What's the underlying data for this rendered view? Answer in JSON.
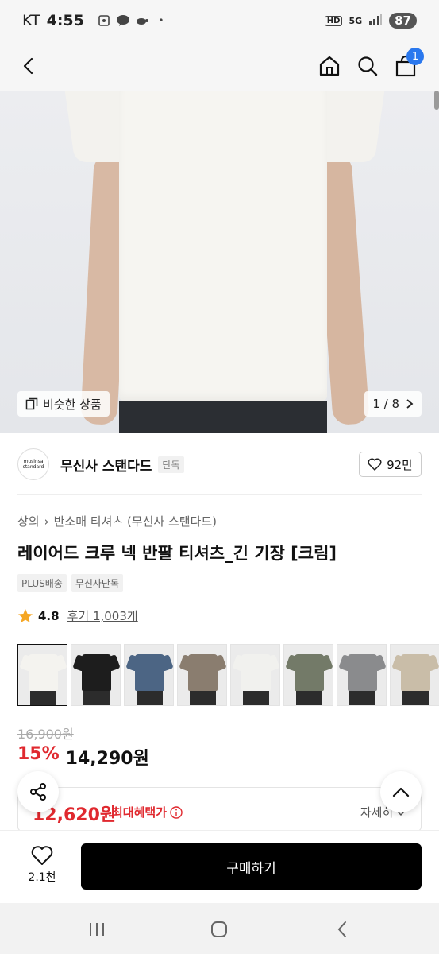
{
  "status_bar": {
    "carrier": "KT",
    "time": "4:55",
    "notification_icons": [
      "screenshot-icon",
      "talk-icon",
      "turtle-icon"
    ],
    "dot": "•",
    "hd": "HD",
    "network": "5G",
    "battery": "87"
  },
  "header": {
    "cart_count": "1"
  },
  "hero": {
    "similar_label": "비슷한 상품",
    "page_indicator": "1 / 8"
  },
  "brand": {
    "logo_line1": "musinsa",
    "logo_line2": "standard",
    "name": "무신사 스탠다드",
    "tag": "단독",
    "likes": "92만"
  },
  "product": {
    "breadcrumb": [
      "상의",
      "반소매 티셔츠 (무신사 스탠다드)"
    ],
    "title": "레이어드 크루 넥 반팔 티셔츠_긴 기장 [크림]",
    "tags": [
      "PLUS배송",
      "무신사단독"
    ],
    "rating": "4.8",
    "reviews": "후기 1,003개",
    "colors": [
      "#f4f3ef",
      "#1d1d1d",
      "#4c6584",
      "#8a7d6f",
      "#f1f1ee",
      "#737a68",
      "#8a8b8d",
      "#c9bda8"
    ]
  },
  "price": {
    "original": "16,900원",
    "discount": "15%",
    "sale": "14,290원",
    "max_benefit_price": "12,620원",
    "max_benefit_label": "최대혜택가",
    "detail_link": "자세히"
  },
  "bottom": {
    "wish_count": "2.1천",
    "buy_label": "구매하기"
  }
}
